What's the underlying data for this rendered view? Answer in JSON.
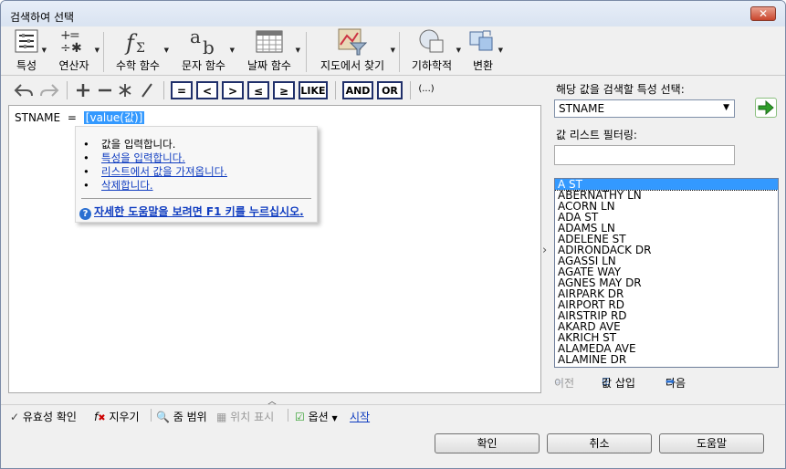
{
  "window": {
    "title": "검색하여 선택",
    "close_symbol": "✕"
  },
  "ribbon": {
    "attributes_label": "특성",
    "operators_label": "연산자",
    "math_label": "수학 함수",
    "string_label": "문자 함수",
    "date_label": "날짜 함수",
    "map_label": "지도에서 찾기",
    "geometry_label": "기하학적",
    "transform_label": "변환"
  },
  "operators": {
    "equals": "=",
    "less": "<",
    "greater": ">",
    "less_equal": "≤",
    "greater_equal": "≥",
    "like": "LIKE",
    "and": "AND",
    "or": "OR",
    "parens": "(...)"
  },
  "editor": {
    "field": "STNAME",
    "operator": "=",
    "placeholder": "[value(값)]",
    "popup": {
      "items": [
        "값을 입력합니다.",
        "특성을 입력합니다.",
        "리스트에서 값을 가져옵니다.",
        "삭제합니다."
      ],
      "help": "자세한 도움말을 보려면 F1 키를 누르십시오."
    }
  },
  "right_panel": {
    "attribute_label": "해당 값을 검색할 특성 선택:",
    "selected_attribute": "STNAME",
    "filter_label": "값 리스트 필터링:",
    "filter_value": "",
    "values": [
      "A ST",
      "ABERNATHY LN",
      "ACORN LN",
      "ADA ST",
      "ADAMS LN",
      "ADELENE ST",
      "ADIRONDACK DR",
      "AGASSI LN",
      "AGATE WAY",
      "AGNES MAY DR",
      "AIRPARK DR",
      "AIRPORT RD",
      "AIRSTRIP RD",
      "AKARD AVE",
      "AKRICH ST",
      "ALAMEDA AVE",
      "ALAMINE DR"
    ],
    "selected_value": "A ST",
    "prev": "이전",
    "insert": "값 삽입",
    "next": "다음"
  },
  "status_bar": {
    "validate": "유효성 확인",
    "clear": "지우기",
    "zoom": "줌 범위",
    "show_location": "위치 표시",
    "options": "옵션",
    "start": "시작"
  },
  "buttons": {
    "ok": "확인",
    "cancel": "취소",
    "help": "도움말"
  },
  "colors": {
    "selection": "#3399ff",
    "link": "#0f3cc0",
    "go_arrow": "#2f9e2a"
  }
}
